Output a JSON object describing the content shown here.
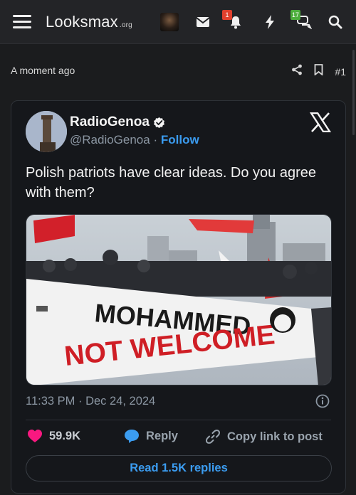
{
  "header": {
    "logo_text": "Looksmax",
    "logo_suffix": ".org",
    "notifications_badge": "1",
    "conversations_badge": "17",
    "icons": [
      "menu-icon",
      "mail-icon",
      "bell-icon",
      "lightning-icon",
      "chat-icon",
      "search-icon"
    ]
  },
  "post": {
    "time": "A moment ago",
    "number": "#1"
  },
  "tweet": {
    "display_name": "RadioGenoa",
    "handle": "@RadioGenoa",
    "separator": "·",
    "follow_label": "Follow",
    "text": "Polish patriots have clear ideas. Do you agree with them?",
    "image_banner_line1": "MOHAMMED",
    "image_banner_line2": "NOT WELCOME",
    "timestamp": "11:33 PM · Dec 24, 2024",
    "likes": "59.9K",
    "reply_label": "Reply",
    "copy_label": "Copy link to post",
    "read_replies_label": "Read 1.5K replies"
  },
  "colors": {
    "accent_blue": "#3b9cf0",
    "like_pink": "#f91880",
    "badge_red": "#e0402d",
    "badge_green": "#4cae3c"
  }
}
